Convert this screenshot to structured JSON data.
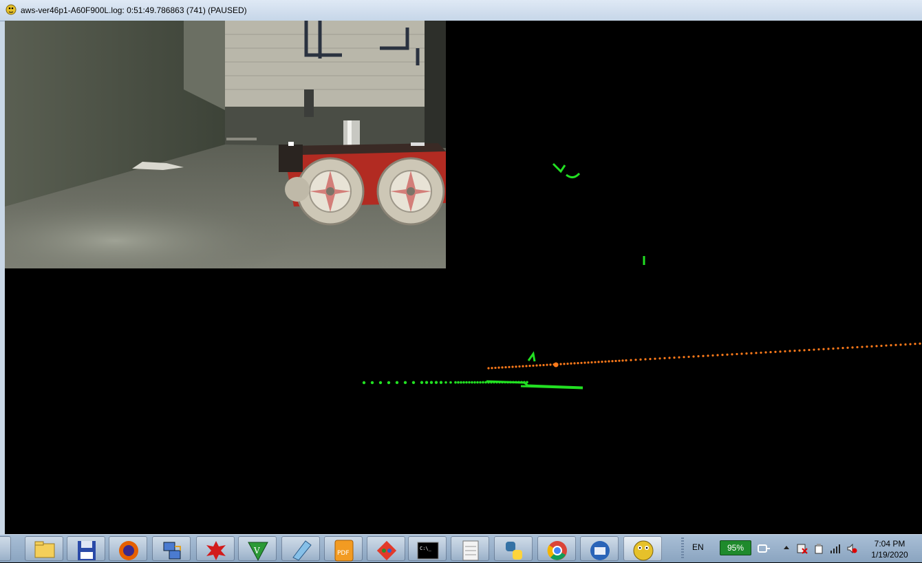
{
  "window": {
    "title": "aws-ver46p1-A60F900L.log: 0:51:49.786863 (741) (PAUSED)",
    "app_icon": "python-snake-icon"
  },
  "view": {
    "camera_scene": "robot in tunnel",
    "colors": {
      "lidar_green": "#22e022",
      "lidar_orange": "#ff7a1a",
      "background": "#000000"
    }
  },
  "taskbar": {
    "apps": [
      {
        "name": "file-explorer-icon"
      },
      {
        "name": "save-floppy-icon"
      },
      {
        "name": "firefox-icon"
      },
      {
        "name": "network-computer-icon"
      },
      {
        "name": "red-splat-icon"
      },
      {
        "name": "vim-icon"
      },
      {
        "name": "notepad-icon"
      },
      {
        "name": "pdf-icon"
      },
      {
        "name": "git-icon"
      },
      {
        "name": "terminal-icon"
      },
      {
        "name": "document-icon"
      },
      {
        "name": "python-icon"
      },
      {
        "name": "chrome-icon"
      },
      {
        "name": "thunderbird-icon"
      },
      {
        "name": "python-snake-icon"
      }
    ],
    "tray": {
      "language": "EN",
      "battery": "95%",
      "time": "7:04 PM",
      "date": "1/19/2020"
    }
  }
}
